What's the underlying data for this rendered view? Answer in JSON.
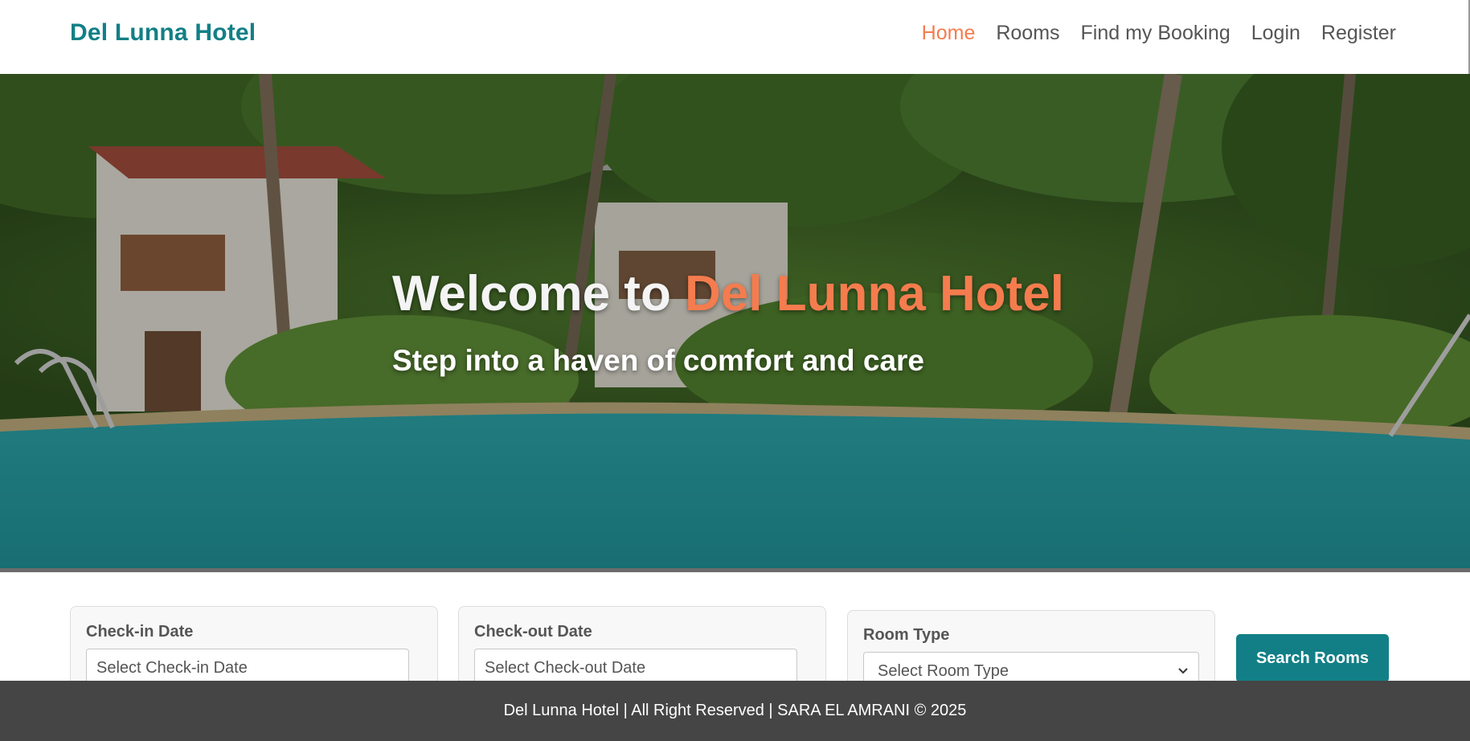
{
  "header": {
    "brand": "Del Lunna Hotel",
    "nav": [
      {
        "label": "Home",
        "active": true
      },
      {
        "label": "Rooms",
        "active": false
      },
      {
        "label": "Find my Booking",
        "active": false
      },
      {
        "label": "Login",
        "active": false
      },
      {
        "label": "Register",
        "active": false
      }
    ]
  },
  "hero": {
    "title_prefix": "Welcome to ",
    "title_accent": "Del Lunna Hotel",
    "subtitle": "Step into a haven of comfort and care"
  },
  "search": {
    "checkin": {
      "label": "Check-in Date",
      "placeholder": "Select Check-in Date"
    },
    "checkout": {
      "label": "Check-out Date",
      "placeholder": "Select Check-out Date"
    },
    "room_type": {
      "label": "Room Type",
      "selected": "Select Room Type"
    },
    "button": "Search Rooms"
  },
  "footer": {
    "text": "Del Lunna Hotel | All Right Reserved | SARA EL AMRANI © 2025"
  },
  "colors": {
    "brand": "#127f86",
    "accent": "#f47c4e",
    "footer_bg": "#454545",
    "nav_text": "#555555"
  },
  "icons": {
    "room_select": "chevron-down-icon"
  }
}
